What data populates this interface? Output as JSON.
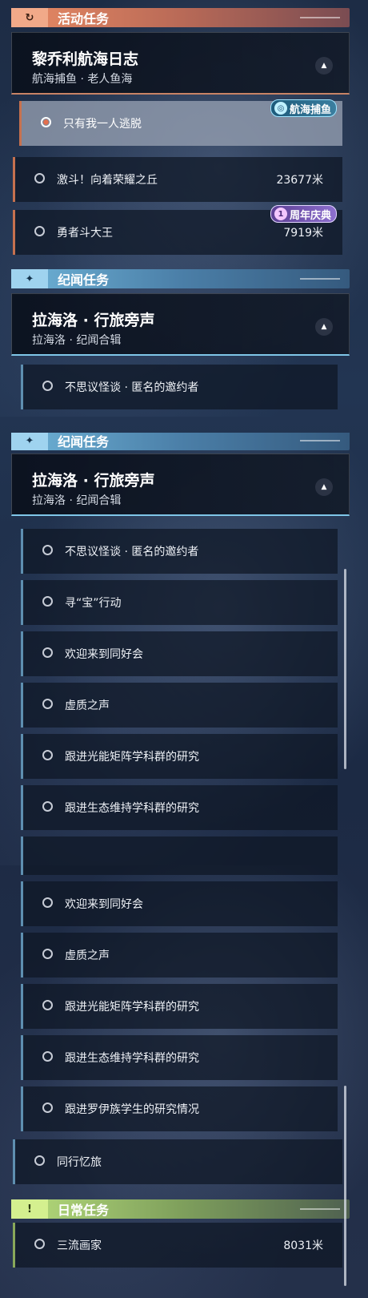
{
  "activity": {
    "header": "活动任务",
    "quest_title": "黎乔利航海日志",
    "quest_sub": "航海捕鱼 · 老人鱼海",
    "items": [
      {
        "label": "只有我一人逃脱",
        "dist": ""
      },
      {
        "label": "激斗！向着荣耀之丘",
        "dist": "23677米"
      },
      {
        "label": "勇者斗大王",
        "dist": "7919米"
      }
    ],
    "badge_fish": "航海捕鱼",
    "badge_anni": "周年庆典"
  },
  "lore": {
    "header": "纪闻任务",
    "quest_title": "拉海洛 · 行旅旁声",
    "quest_sub": "拉海洛 · 纪闻合辑",
    "items": [
      {
        "label": "不思议怪谈 · 匿名的邀约者"
      },
      {
        "label": "寻“宝”行动"
      },
      {
        "label": "欢迎来到同好会"
      },
      {
        "label": "虚质之声"
      },
      {
        "label": "跟进光能矩阵学科群的研究"
      },
      {
        "label": "跟进生态维持学科群的研究"
      },
      {
        "label": "跟进罗伊族学生的研究情况"
      }
    ],
    "companion": "同行忆旅"
  },
  "daily": {
    "header": "日常任务",
    "items": [
      {
        "label": "三流画家",
        "dist": "8031米"
      }
    ]
  },
  "icons": {
    "activity_icon": "refresh-arrow-icon",
    "lore_icon": "sparkle-icon",
    "daily_icon": "exclamation-icon",
    "toggle_icon": "chevron-up-icon"
  },
  "colors": {
    "activity_accent": "#e88a64",
    "lore_accent": "#6fb4d8",
    "daily_accent": "#b8de7c"
  }
}
